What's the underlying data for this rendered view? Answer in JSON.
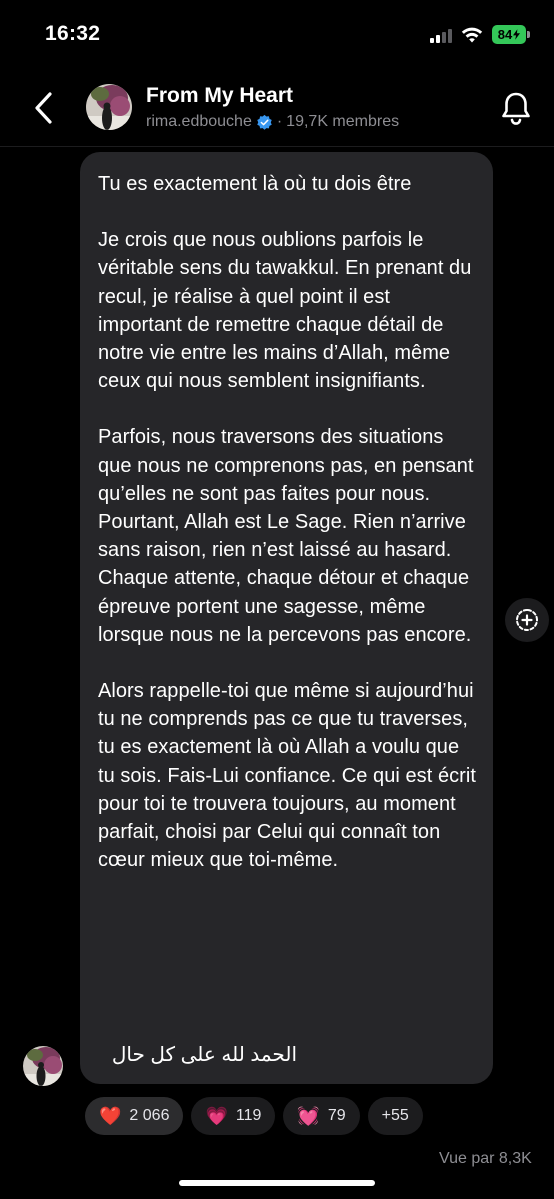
{
  "status_bar": {
    "time": "16:32",
    "battery": "84"
  },
  "header": {
    "title": "From My Heart",
    "username": "rima.edbouche",
    "members": "19,7K membres"
  },
  "message": {
    "paragraphs": [
      "Tu es exactement là où tu dois être",
      "Je crois que nous oublions parfois le véritable sens du tawakkul. En prenant du recul, je réalise à quel point il est important de remettre chaque détail de notre vie entre les mains d’Allah, même ceux qui nous semblent insignifiants.",
      "Parfois, nous traversons des situations que nous ne comprenons pas, en pensant qu’elles ne sont pas faites pour nous. Pourtant, Allah est Le Sage. Rien n’arrive sans raison, rien n’est laissé au hasard. Chaque attente, chaque détour et chaque épreuve portent une sagesse, même lorsque nous ne la percevons pas encore.",
      "Alors rappelle-toi que même si aujourd’hui tu ne comprends pas ce que tu traverses, tu es exactement là où Allah a voulu que tu sois. Fais-Lui confiance. Ce qui est écrit pour toi te trouvera toujours, au moment parfait, choisi par Celui qui connaît ton cœur mieux que toi-même."
    ],
    "arabic": "الحمد لله على كل حال"
  },
  "reactions": [
    {
      "emoji": "❤️",
      "count": "2 066"
    },
    {
      "emoji": "💗",
      "count": "119"
    },
    {
      "emoji": "💓",
      "count": "79"
    },
    {
      "emoji": "",
      "count": "+55"
    }
  ],
  "views": "Vue par 8,3K",
  "icons": {
    "back": "chevron-left-icon",
    "notifications": "bell-icon",
    "verified": "verified-badge-icon",
    "add_reaction": "add-reaction-icon"
  },
  "colors": {
    "background": "#000000",
    "bubble": "#262629",
    "secondary_text": "#8e8e93",
    "verified": "#3897f0",
    "battery": "#34c759"
  }
}
